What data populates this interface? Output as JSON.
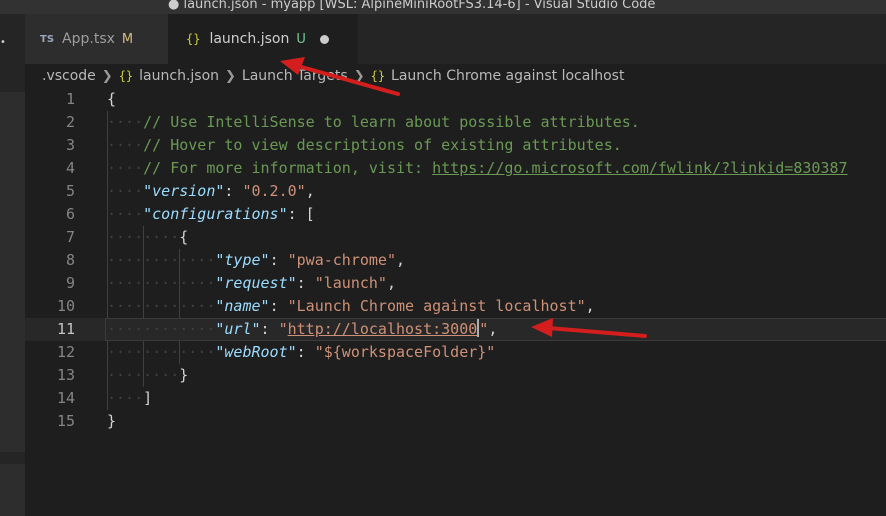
{
  "window": {
    "title": "● launch.json - myapp [WSL: AlpineMiniRootFS3.14-6] - Visual Studio Code"
  },
  "tabs": [
    {
      "icon": "TS",
      "label": "App.tsx",
      "status": "M"
    },
    {
      "icon": "{}",
      "label": "launch.json",
      "status": "U",
      "dirty": true
    }
  ],
  "breadcrumb": {
    "folder": ".vscode",
    "file_icon": "{}",
    "file": "launch.json",
    "section": "Launch Targets",
    "item_icon": "{}",
    "item": "Launch Chrome against localhost"
  },
  "editor": {
    "current_line": 11,
    "lines": [
      {
        "n": "1",
        "indent": "",
        "parts": [
          {
            "t": "{",
            "c": "punc"
          }
        ]
      },
      {
        "n": "2",
        "indent": "····",
        "parts": [
          {
            "t": "// Use IntelliSense to learn about possible attributes.",
            "c": "comment"
          }
        ]
      },
      {
        "n": "3",
        "indent": "····",
        "parts": [
          {
            "t": "// Hover to view descriptions of existing attributes.",
            "c": "comment"
          }
        ]
      },
      {
        "n": "4",
        "indent": "····",
        "parts": [
          {
            "t": "// For more information, visit: ",
            "c": "comment"
          },
          {
            "t": "https://go.microsoft.com/fwlink/?linkid=830387",
            "c": "link"
          }
        ]
      },
      {
        "n": "5",
        "indent": "····",
        "parts": [
          {
            "t": "\"version\"",
            "c": "key"
          },
          {
            "t": ": ",
            "c": "punc"
          },
          {
            "t": "\"0.2.0\"",
            "c": "str"
          },
          {
            "t": ",",
            "c": "punc"
          }
        ]
      },
      {
        "n": "6",
        "indent": "····",
        "parts": [
          {
            "t": "\"configurations\"",
            "c": "key"
          },
          {
            "t": ": [",
            "c": "punc"
          }
        ]
      },
      {
        "n": "7",
        "indent": "········",
        "parts": [
          {
            "t": "{",
            "c": "punc"
          }
        ]
      },
      {
        "n": "8",
        "indent": "············",
        "parts": [
          {
            "t": "\"type\"",
            "c": "key"
          },
          {
            "t": ": ",
            "c": "punc"
          },
          {
            "t": "\"pwa-chrome\"",
            "c": "str"
          },
          {
            "t": ",",
            "c": "punc"
          }
        ]
      },
      {
        "n": "9",
        "indent": "············",
        "parts": [
          {
            "t": "\"request\"",
            "c": "key"
          },
          {
            "t": ": ",
            "c": "punc"
          },
          {
            "t": "\"launch\"",
            "c": "str"
          },
          {
            "t": ",",
            "c": "punc"
          }
        ]
      },
      {
        "n": "10",
        "indent": "············",
        "parts": [
          {
            "t": "\"name\"",
            "c": "key"
          },
          {
            "t": ": ",
            "c": "punc"
          },
          {
            "t": "\"Launch Chrome against localhost\"",
            "c": "str"
          },
          {
            "t": ",",
            "c": "punc"
          }
        ]
      },
      {
        "n": "11",
        "indent": "············",
        "parts": [
          {
            "t": "\"url\"",
            "c": "key"
          },
          {
            "t": ": ",
            "c": "punc"
          },
          {
            "t": "\"",
            "c": "str"
          },
          {
            "t": "http://localhost:3000",
            "c": "url"
          },
          {
            "t": "CURSOR",
            "c": "cursor"
          },
          {
            "t": "\"",
            "c": "str"
          },
          {
            "t": ",",
            "c": "punc"
          }
        ]
      },
      {
        "n": "12",
        "indent": "············",
        "parts": [
          {
            "t": "\"webRoot\"",
            "c": "key"
          },
          {
            "t": ": ",
            "c": "punc"
          },
          {
            "t": "\"${workspaceFolder}\"",
            "c": "str"
          }
        ]
      },
      {
        "n": "13",
        "indent": "········",
        "parts": [
          {
            "t": "}",
            "c": "punc"
          }
        ]
      },
      {
        "n": "14",
        "indent": "····",
        "parts": [
          {
            "t": "]",
            "c": "punc"
          }
        ]
      },
      {
        "n": "15",
        "indent": "",
        "parts": [
          {
            "t": "}",
            "c": "punc"
          }
        ]
      }
    ]
  },
  "colors": {
    "annotation_arrow": "#d41e1e",
    "comment": "#6a9955",
    "key": "#9cdcfe",
    "string": "#ce9178"
  }
}
